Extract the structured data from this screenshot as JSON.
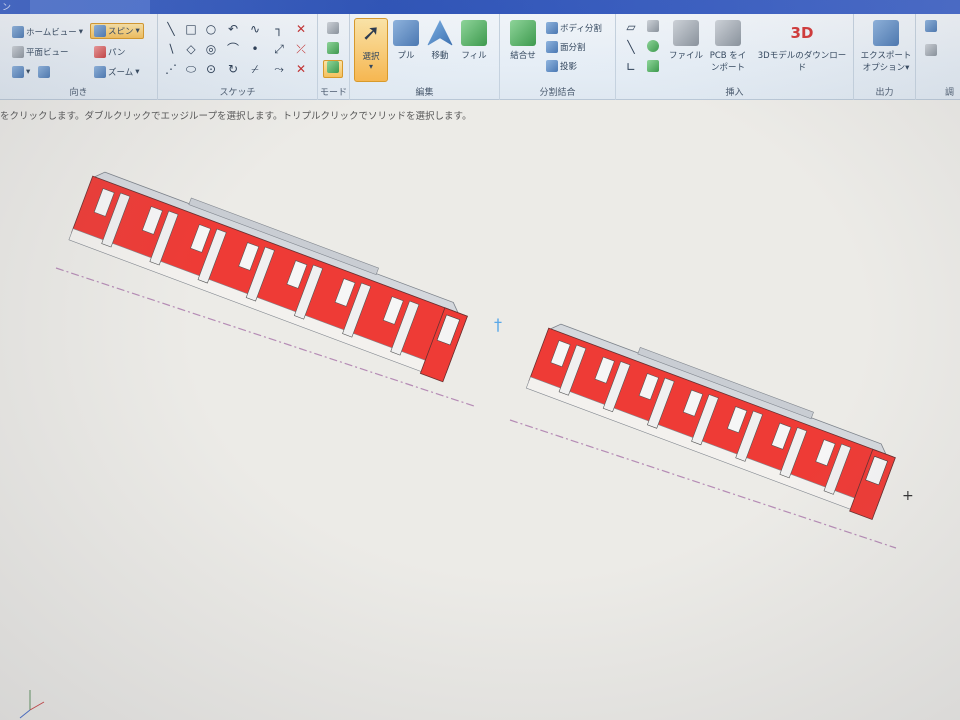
{
  "titlebar": {
    "text": "ン"
  },
  "ribbon": {
    "groups": {
      "orientation": {
        "label": "向き",
        "home_view": "ホームビュー",
        "plan_view": "平面ビュー",
        "spin": "スピン",
        "pan": "パン",
        "zoom": "ズーム"
      },
      "sketch": {
        "label": "スケッチ"
      },
      "mode": {
        "label": "モード"
      },
      "edit": {
        "label": "編集",
        "select": "選択",
        "pull": "プル",
        "move": "移動",
        "fill": "フィル"
      },
      "intersect": {
        "label": "分割結合",
        "combine": "結合せ",
        "split_body": "ボディ分割",
        "split_face": "面分割",
        "project": "投影"
      },
      "insert": {
        "label": "挿入",
        "file": "ファイル",
        "pcb_line1": "PCB をイ",
        "pcb_line2": "ンポート",
        "download_3d": "3Dモデルのダウンロード",
        "logo_3d": "3D"
      },
      "output": {
        "label": "出力",
        "export_line1": "エクスポート",
        "export_line2": "オプション"
      },
      "adjust": {
        "label": "調"
      }
    }
  },
  "status_hint": "をクリックします。ダブルクリックでエッジループを選択します。トリプルクリックでソリッドを選択します。",
  "colors": {
    "train_body": "#ee3b36",
    "train_roof": "#d4d8dd",
    "train_skirt": "#f3f1ee",
    "axis_line": "#b58bb5",
    "canvas_bg": "#ecebe7"
  }
}
